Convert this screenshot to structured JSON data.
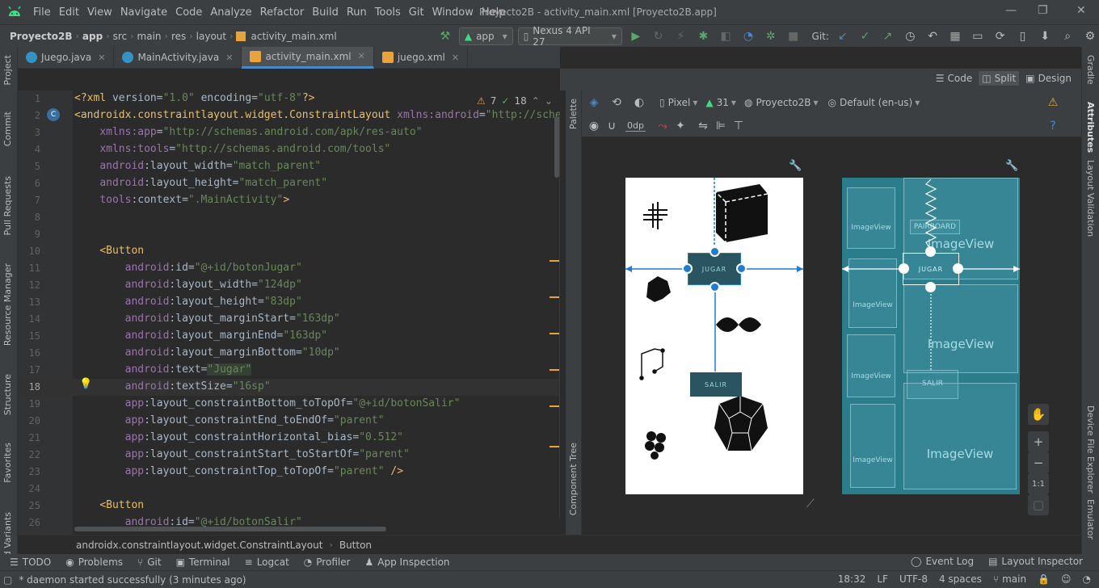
{
  "menu": {
    "items": [
      "File",
      "Edit",
      "View",
      "Navigate",
      "Code",
      "Analyze",
      "Refactor",
      "Build",
      "Run",
      "Tools",
      "Git",
      "Window",
      "Help"
    ],
    "window_title": "Proyecto2B - activity_main.xml [Proyecto2B.app]"
  },
  "nav": {
    "crumbs": [
      "Proyecto2B",
      "app",
      "src",
      "main",
      "res",
      "layout",
      "activity_main.xml"
    ],
    "run_config": "app",
    "device": "Nexus 4 API 27",
    "git_label": "Git:"
  },
  "tabs": [
    {
      "label": "Juego.java",
      "color": "#3592c4"
    },
    {
      "label": "MainActivity.java",
      "color": "#3592c4"
    },
    {
      "label": "activity_main.xml",
      "color": "#e8a33d"
    },
    {
      "label": "juego.xml",
      "color": "#e8a33d"
    }
  ],
  "view_modes": {
    "code": "Code",
    "split": "Split",
    "design": "Design"
  },
  "inspection": {
    "warnings": "7",
    "weak": "18"
  },
  "code_lines": [
    {
      "n": "1",
      "html": "<span class='t-pi'>&lt;?xml</span> <span class='t-pl'>version=</span><span class='t-av'>\"1.0\"</span> <span class='t-pl'>encoding=</span><span class='t-av'>\"utf-8\"</span><span class='t-pi'>?&gt;</span>"
    },
    {
      "n": "2",
      "html": "<span class='t-tag'>&lt;androidx.constraintlayout.widget.ConstraintLayout</span> <span class='t-an'>xmlns:android</span><span class='t-pl'>=</span><span class='t-av'>\"http://sche</span>"
    },
    {
      "n": "3",
      "html": "    <span class='t-an'>xmlns:app</span><span class='t-pl'>=</span><span class='t-av'>\"http://schemas.android.com/apk/res-auto\"</span>"
    },
    {
      "n": "4",
      "html": "    <span class='t-an'>xmlns:tools</span><span class='t-pl'>=</span><span class='t-av'>\"http://schemas.android.com/tools\"</span>"
    },
    {
      "n": "5",
      "html": "    <span class='t-an'>android</span><span class='t-pl'>:layout_width=</span><span class='t-av'>\"match_parent\"</span>"
    },
    {
      "n": "6",
      "html": "    <span class='t-an'>android</span><span class='t-pl'>:layout_height=</span><span class='t-av'>\"match_parent\"</span>"
    },
    {
      "n": "7",
      "html": "    <span class='t-an'>tools</span><span class='t-pl'>:context=</span><span class='t-av'>\".MainActivity\"</span><span class='t-tag'>&gt;</span>"
    },
    {
      "n": "8",
      "html": ""
    },
    {
      "n": "9",
      "html": ""
    },
    {
      "n": "10",
      "html": "    <span class='t-tag'>&lt;Button</span>"
    },
    {
      "n": "11",
      "html": "        <span class='t-an'>android</span><span class='t-pl'>:id=</span><span class='t-av'>\"@+id/botonJugar\"</span>"
    },
    {
      "n": "12",
      "html": "        <span class='t-an'>android</span><span class='t-pl'>:layout_width=</span><span class='t-av'>\"124dp\"</span>"
    },
    {
      "n": "13",
      "html": "        <span class='t-an'>android</span><span class='t-pl'>:layout_height=</span><span class='t-av'>\"83dp\"</span>"
    },
    {
      "n": "14",
      "html": "        <span class='t-an'>android</span><span class='t-pl'>:layout_marginStart=</span><span class='t-av'>\"163dp\"</span>"
    },
    {
      "n": "15",
      "html": "        <span class='t-an'>android</span><span class='t-pl'>:layout_marginEnd=</span><span class='t-av'>\"163dp\"</span>"
    },
    {
      "n": "16",
      "html": "        <span class='t-an'>android</span><span class='t-pl'>:layout_marginBottom=</span><span class='t-av'>\"10dp\"</span>"
    },
    {
      "n": "17",
      "html": "        <span class='t-an'>android</span><span class='t-pl'>:text=</span><span class='t-av' style='background:#344134'>\"Jugar\"</span>"
    },
    {
      "n": "18",
      "html": "        <span class='t-an'>android</span><span class='t-pl'>:textSize=</span><span class='t-av'>\"16sp\"</span>",
      "current": true
    },
    {
      "n": "19",
      "html": "        <span class='t-an'>app</span><span class='t-pl'>:layout_constraintBottom_toTopOf=</span><span class='t-av'>\"@+id/botonSalir\"</span>"
    },
    {
      "n": "20",
      "html": "        <span class='t-an'>app</span><span class='t-pl'>:layout_constraintEnd_toEndOf=</span><span class='t-av'>\"parent\"</span>"
    },
    {
      "n": "21",
      "html": "        <span class='t-an'>app</span><span class='t-pl'>:layout_constraintHorizontal_bias=</span><span class='t-av'>\"0.512\"</span>"
    },
    {
      "n": "22",
      "html": "        <span class='t-an'>app</span><span class='t-pl'>:layout_constraintStart_toStartOf=</span><span class='t-av'>\"parent\"</span>"
    },
    {
      "n": "23",
      "html": "        <span class='t-an'>app</span><span class='t-pl'>:layout_constraintTop_toTopOf=</span><span class='t-av'>\"parent\"</span> <span class='t-tag'>/&gt;</span>"
    },
    {
      "n": "24",
      "html": ""
    },
    {
      "n": "25",
      "html": "    <span class='t-tag'>&lt;Button</span>"
    },
    {
      "n": "26",
      "html": "        <span class='t-an'>android</span><span class='t-pl'>:id=</span><span class='t-av'>\"@+id/botonSalir\"</span>"
    }
  ],
  "design_toolbar": {
    "device": "Pixel",
    "api": "31",
    "theme": "Proyecto2B",
    "locale": "Default (en-us)",
    "margin": "0dp"
  },
  "preview": {
    "jugar": "JUGAR",
    "salir": "SALIR"
  },
  "blueprint": {
    "imageview": "ImageView",
    "pairboard": "PAIRBOARD",
    "jugar": "JUGAR",
    "salir": "SALIR"
  },
  "palette_label": "Palette",
  "component_tree_label": "Component Tree",
  "left_tools": [
    "Project",
    "Commit",
    "Pull Requests",
    "Resource Manager",
    "Structure",
    "Favorites",
    "Build Variants"
  ],
  "right_tools": [
    "Gradle",
    "Attributes",
    "Layout Validation",
    "Device File Explorer",
    "Emulator"
  ],
  "bottom_breadcrumb": [
    "androidx.constraintlayout.widget.ConstraintLayout",
    "Button"
  ],
  "bottom_tools": [
    "TODO",
    "Problems",
    "Git",
    "Terminal",
    "Logcat",
    "Profiler",
    "App Inspection"
  ],
  "bottom_right_tools": [
    "Event Log",
    "Layout Inspector"
  ],
  "status": {
    "message": "* daemon started successfully (3 minutes ago)",
    "position": "18:32",
    "line_sep": "LF",
    "encoding": "UTF-8",
    "indent": "4 spaces",
    "branch": "main"
  },
  "zoom": {
    "fit": "1:1"
  }
}
